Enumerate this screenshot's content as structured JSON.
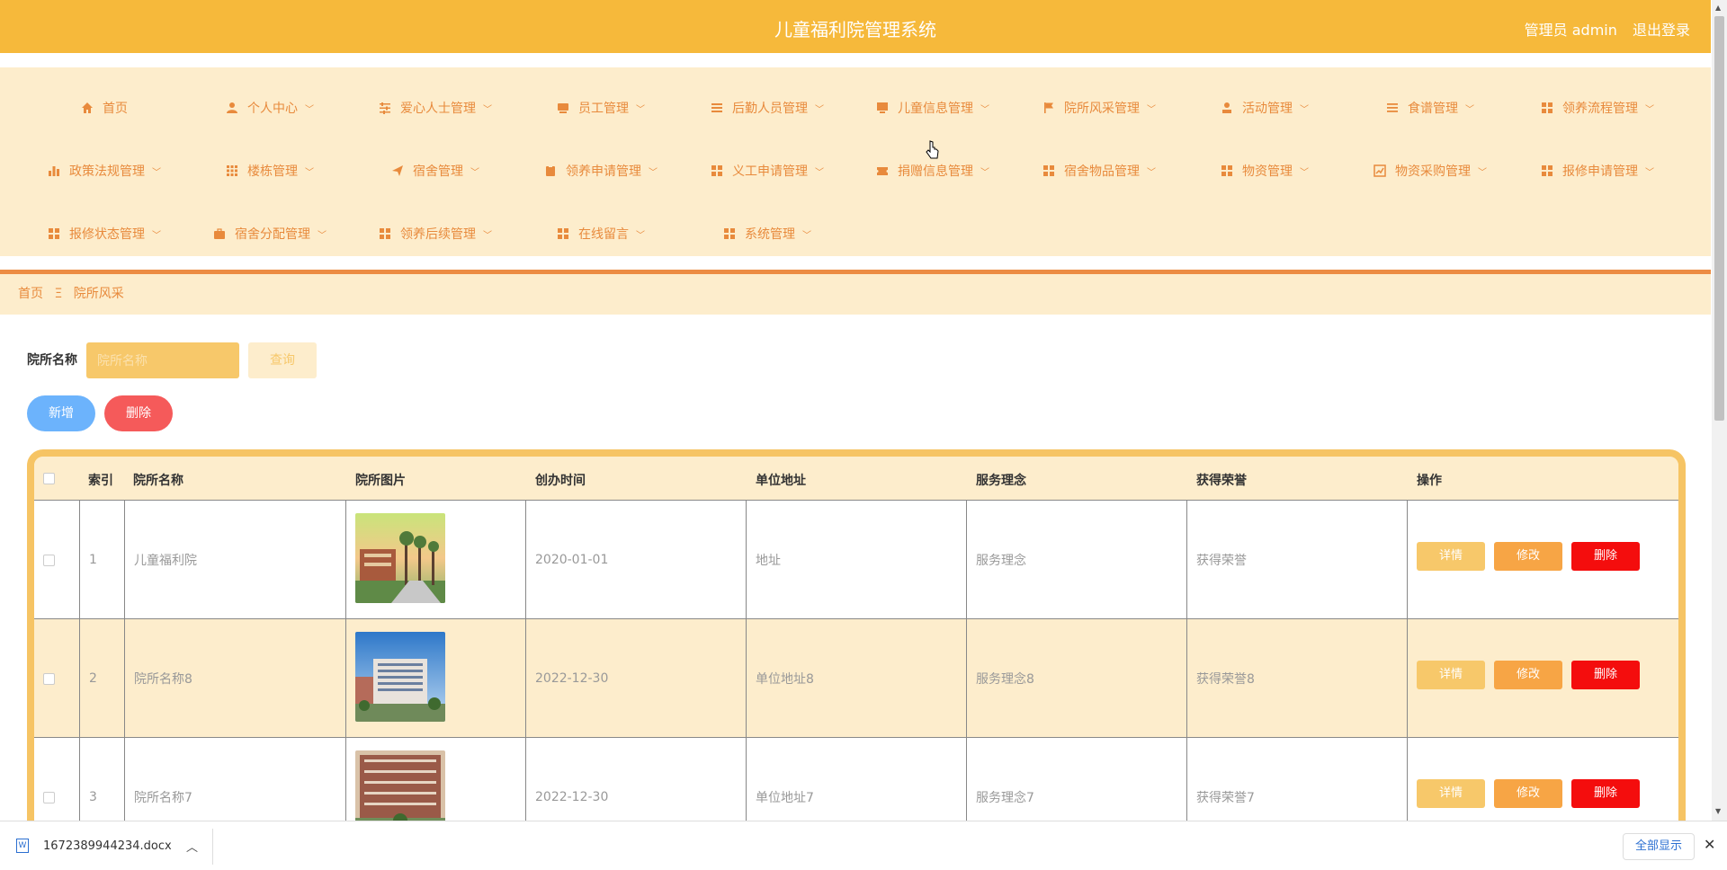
{
  "header": {
    "title": "儿童福利院管理系统",
    "user": "管理员 admin",
    "logout": "退出登录"
  },
  "nav": [
    {
      "label": "首页",
      "icon": "home-icon",
      "chev": false
    },
    {
      "label": "个人中心",
      "icon": "user-icon",
      "chev": true
    },
    {
      "label": "爱心人士管理",
      "icon": "sliders-icon",
      "chev": true
    },
    {
      "label": "员工管理",
      "icon": "card-icon",
      "chev": true
    },
    {
      "label": "后勤人员管理",
      "icon": "list-icon",
      "chev": true
    },
    {
      "label": "儿童信息管理",
      "icon": "monitor-icon",
      "chev": true
    },
    {
      "label": "院所风采管理",
      "icon": "flag-icon",
      "chev": true
    },
    {
      "label": "活动管理",
      "icon": "person-icon",
      "chev": true
    },
    {
      "label": "食谱管理",
      "icon": "menu-icon",
      "chev": true
    },
    {
      "label": "领养流程管理",
      "icon": "grid-icon",
      "chev": true
    },
    {
      "label": "政策法规管理",
      "icon": "bar-chart-icon",
      "chev": true
    },
    {
      "label": "楼栋管理",
      "icon": "grid9-icon",
      "chev": true
    },
    {
      "label": "宿舍管理",
      "icon": "send-icon",
      "chev": true
    },
    {
      "label": "领养申请管理",
      "icon": "clipboard-icon",
      "chev": true
    },
    {
      "label": "义工申请管理",
      "icon": "grid-icon",
      "chev": true
    },
    {
      "label": "捐赠信息管理",
      "icon": "ticket-icon",
      "chev": true
    },
    {
      "label": "宿舍物品管理",
      "icon": "grid-icon",
      "chev": true
    },
    {
      "label": "物资管理",
      "icon": "grid-icon",
      "chev": true
    },
    {
      "label": "物资采购管理",
      "icon": "trend-icon",
      "chev": true
    },
    {
      "label": "报修申请管理",
      "icon": "grid-icon",
      "chev": true
    },
    {
      "label": "报修状态管理",
      "icon": "grid-icon",
      "chev": true
    },
    {
      "label": "宿舍分配管理",
      "icon": "briefcase-icon",
      "chev": true
    },
    {
      "label": "领养后续管理",
      "icon": "grid-icon",
      "chev": true
    },
    {
      "label": "在线留言",
      "icon": "grid-icon",
      "chev": true
    },
    {
      "label": "系统管理",
      "icon": "grid-icon",
      "chev": true
    }
  ],
  "breadcrumb": {
    "home": "首页",
    "sep": "Ξ",
    "current": "院所风采"
  },
  "search": {
    "label": "院所名称",
    "placeholder": "院所名称",
    "button": "查询"
  },
  "actions": {
    "add": "新增",
    "delete": "删除"
  },
  "table": {
    "columns": [
      "索引",
      "院所名称",
      "院所图片",
      "创办时间",
      "单位地址",
      "服务理念",
      "获得荣誉",
      "操作"
    ],
    "rows": [
      {
        "index": "1",
        "name": "儿童福利院",
        "date": "2020-01-01",
        "address": "地址",
        "idea": "服务理念",
        "honor": "获得荣誉",
        "img": "sunset"
      },
      {
        "index": "2",
        "name": "院所名称8",
        "date": "2022-12-30",
        "address": "单位地址8",
        "idea": "服务理念8",
        "honor": "获得荣誉8",
        "img": "sky"
      },
      {
        "index": "3",
        "name": "院所名称7",
        "date": "2022-12-30",
        "address": "单位地址7",
        "idea": "服务理念7",
        "honor": "获得荣誉7",
        "img": "brick"
      }
    ],
    "row_buttons": {
      "detail": "详情",
      "edit": "修改",
      "delete": "删除"
    }
  },
  "download": {
    "file": "1672389944234.docx",
    "show_all": "全部显示"
  }
}
